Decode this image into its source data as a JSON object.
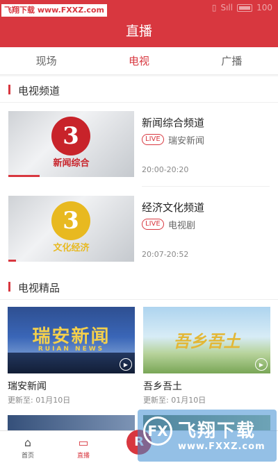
{
  "status_bar": {
    "watermark": "飞翔下载 www.FXXZ.com",
    "signal_text": "Sıll",
    "battery": "100"
  },
  "header": {
    "title": "直播"
  },
  "tabs": [
    {
      "label": "现场"
    },
    {
      "label": "电视"
    },
    {
      "label": "广播"
    }
  ],
  "tv_channels": {
    "section_title": "电视频道",
    "items": [
      {
        "name": "新闻综合频道",
        "badge": "LIVE",
        "program": "瑞安新闻",
        "time": "20:00-20:20",
        "logo_text": "新闻综合",
        "logo_color": "#c8232a",
        "progress": 0.25
      },
      {
        "name": "经济文化频道",
        "badge": "LIVE",
        "program": "电视剧",
        "time": "20:07-20:52",
        "logo_text": "文化经济",
        "logo_color": "#e8b920",
        "progress": 0.06
      }
    ]
  },
  "tv_premium": {
    "section_title": "电视精品",
    "items": [
      {
        "title": "瑞安新闻",
        "update": "更新至: 01月10日",
        "image_text": "瑞安新闻",
        "image_sub": "RUIAN NEWS"
      },
      {
        "title": "吾乡吾土",
        "update": "更新至: 01月10日",
        "image_text": "吾乡吾土"
      }
    ]
  },
  "bottom_nav": {
    "items": [
      {
        "label": "首页",
        "icon": "home-icon"
      },
      {
        "label": "直播",
        "icon": "video-camera-icon"
      }
    ]
  },
  "watermark": {
    "logo_text": "FX",
    "title": "飞翔下载",
    "url": "www.FXXZ.com"
  }
}
